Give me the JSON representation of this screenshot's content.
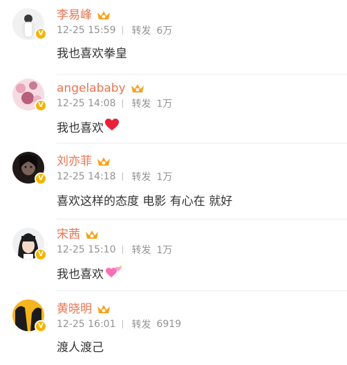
{
  "comments": [
    {
      "username": "李易峰",
      "time": "12-25 15:59",
      "repost_label": "转发",
      "repost_count": "6万",
      "text": "我也喜欢拳皇",
      "emoji": "",
      "verified_badge": "V",
      "avatar_icon": "user-avatar-white-outfit",
      "vip_icon": "vip-crown-icon"
    },
    {
      "username": "angelababy",
      "time": "12-25 14:08",
      "repost_label": "转发",
      "repost_count": "1万",
      "text": "我也喜欢",
      "emoji": "red-heart",
      "verified_badge": "V",
      "avatar_icon": "user-avatar-pink-flowers",
      "vip_icon": "vip-crown-icon"
    },
    {
      "username": "刘亦菲",
      "time": "12-25 14:18",
      "repost_label": "转发",
      "repost_count": "1万",
      "text": "喜欢这样的态度 电影 有心在 就好",
      "emoji": "",
      "verified_badge": "V",
      "avatar_icon": "user-avatar-dark-portrait",
      "vip_icon": "vip-crown-icon"
    },
    {
      "username": "宋茜",
      "time": "12-25 15:10",
      "repost_label": "转发",
      "repost_count": "1万",
      "text": "我也喜欢",
      "emoji": "sparkling-pink-hearts",
      "verified_badge": "V",
      "avatar_icon": "user-avatar-girl-bangs",
      "vip_icon": "vip-crown-icon"
    },
    {
      "username": "黄晓明",
      "time": "12-25 16:01",
      "repost_label": "转发",
      "repost_count": "6919",
      "text": "渡人渡己",
      "emoji": "",
      "verified_badge": "V",
      "avatar_icon": "user-avatar-yellow-silhouette",
      "vip_icon": "vip-crown-icon"
    }
  ],
  "colors": {
    "username": "#eb7350",
    "meta": "#929292",
    "body_text": "#333333",
    "verified_badge": "#f4b400",
    "divider": "#ececec"
  }
}
